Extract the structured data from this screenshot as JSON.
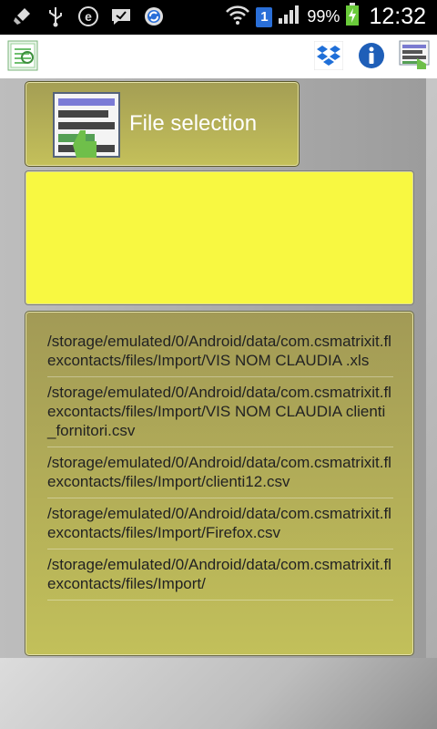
{
  "status_bar": {
    "icons": [
      "broom-icon",
      "usb-icon",
      "e-icon",
      "chat-icon",
      "sync-icon"
    ],
    "sim_label": "1",
    "battery_percent": "99%",
    "time": "12:32"
  },
  "action_bar": {
    "app_icon": "contacts-app-icon",
    "buttons": [
      "dropbox-icon",
      "info-icon",
      "file-select-icon"
    ]
  },
  "file_button": {
    "label": "File selection"
  },
  "file_list": {
    "items": [
      "/storage/emulated/0/Android/data/com.csmatrixit.flexcontacts/files/Import/VIS NOM CLAUDIA .xls",
      "/storage/emulated/0/Android/data/com.csmatrixit.flexcontacts/files/Import/VIS NOM CLAUDIA  clienti_fornitori.csv",
      "/storage/emulated/0/Android/data/com.csmatrixit.flexcontacts/files/Import/clienti12.csv",
      "/storage/emulated/0/Android/data/com.csmatrixit.flexcontacts/files/Import/Firefox.csv",
      "/storage/emulated/0/Android/data/com.csmatrixit.flexcontacts/files/Import/"
    ]
  },
  "colors": {
    "accent_yellow": "#f8f841",
    "olive_panel": "#b2ad58",
    "info_blue": "#1f5fb8"
  }
}
